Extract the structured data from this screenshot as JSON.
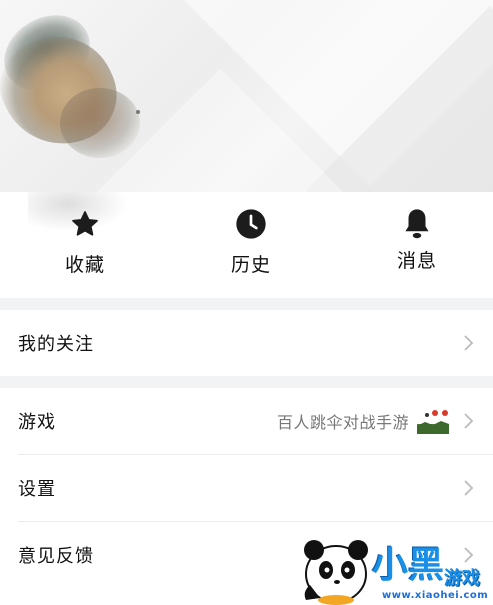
{
  "quick_actions": [
    {
      "label": "收藏",
      "icon": "star-icon"
    },
    {
      "label": "历史",
      "icon": "clock-icon"
    },
    {
      "label": "消息",
      "icon": "bell-icon"
    }
  ],
  "menu": {
    "follow": {
      "label": "我的关注"
    },
    "games": {
      "label": "游戏",
      "detail": "百人跳伞对战手游"
    },
    "settings": {
      "label": "设置"
    },
    "feedback": {
      "label": "意见反馈"
    }
  },
  "watermark": {
    "brand_char1": "小",
    "brand_char2": "黑",
    "brand_suffix": "游戏",
    "site": "www.xiaohei.com"
  },
  "colors": {
    "section_gap": "#f2f3f5",
    "icon": "#1c1c1c",
    "chevron": "#bbbbbb",
    "watermark_blue": "#1a8fe8"
  }
}
